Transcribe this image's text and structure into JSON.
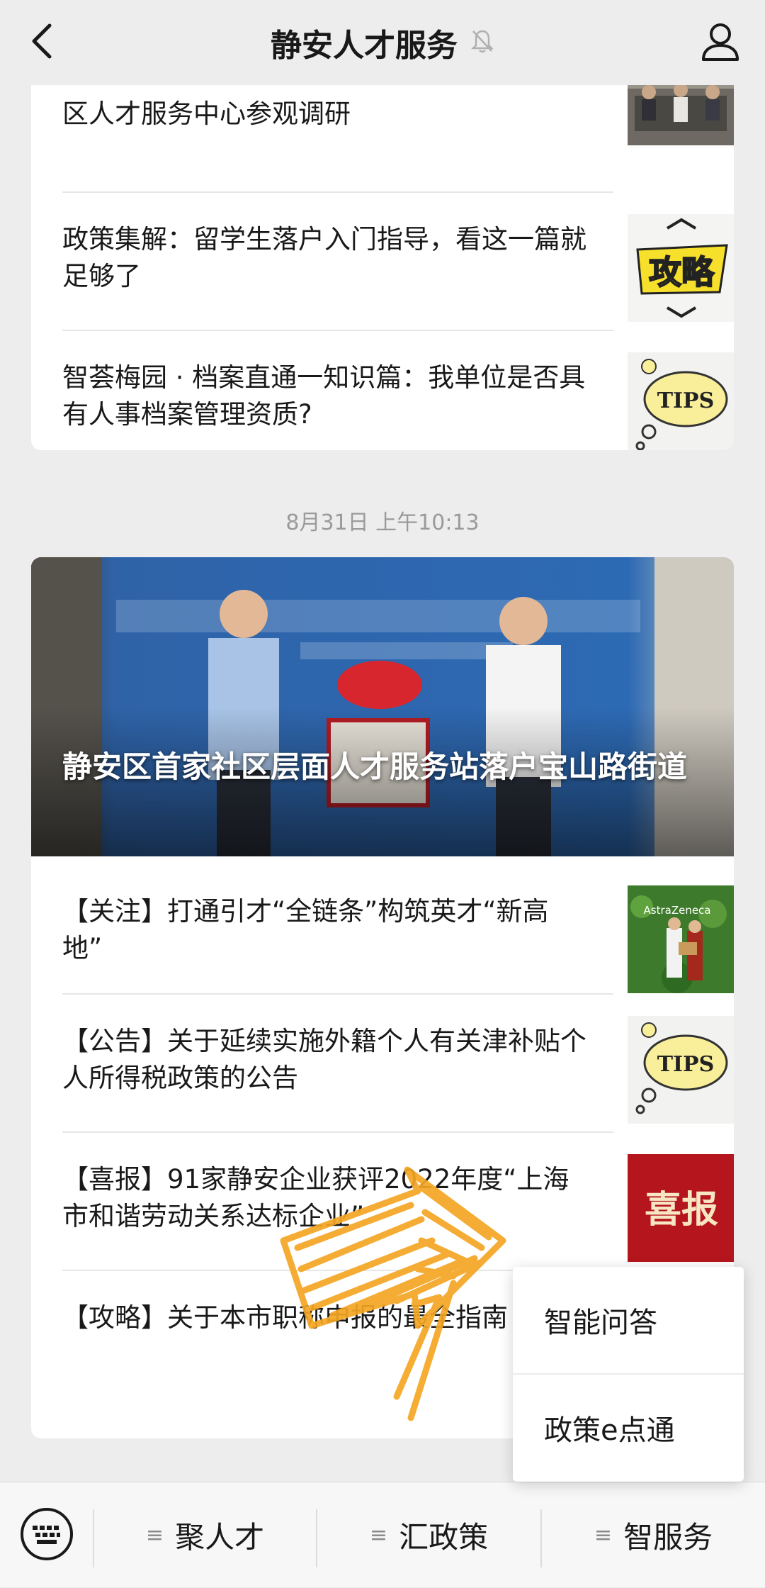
{
  "header": {
    "title": "静安人才服务"
  },
  "feed": {
    "card1_items": [
      {
        "title": "区人才服务中心参观调研"
      },
      {
        "title": "政策集解：留学生落户入门指导，看这一篇就足够了"
      },
      {
        "title": "智荟梅园 · 档案直通一知识篇：我单位是否具有人事档案管理资质?"
      }
    ],
    "timestamp": "8月31日 上午10:13",
    "card2": {
      "hero_title": "静安区首家社区层面人才服务站落户宝山路街道",
      "items": [
        {
          "title": "【关注】打通引才“全链条”构筑英才“新高地”"
        },
        {
          "title": "【公告】关于延续实施外籍个人有关津补贴个人所得税政策的公告"
        },
        {
          "title": "【喜报】91家静安企业获评2022年度“上海市和谐劳动关系达标企业”"
        },
        {
          "title": "【攻略】关于本市职称申报的最全指南"
        }
      ]
    },
    "thumb_text": {
      "tips": "TIPS",
      "gonglue": "攻略",
      "xibao": "喜报",
      "astrazeneca": "AstraZeneca"
    }
  },
  "popup": {
    "items": [
      "智能问答",
      "政策e点通"
    ]
  },
  "bottom_menu": {
    "items": [
      "聚人才",
      "汇政策",
      "智服务"
    ]
  },
  "colors": {
    "background": "#ededed",
    "card": "#ffffff",
    "annotation_arrow": "#f5a623"
  }
}
